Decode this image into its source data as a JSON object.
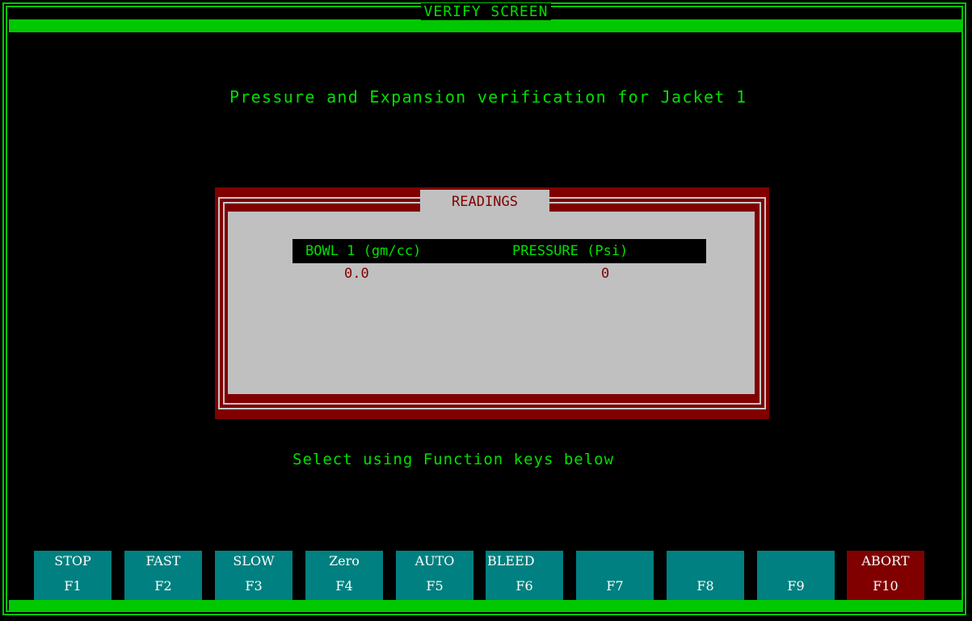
{
  "screen_title": "VERIFY SCREEN",
  "subtitle": "Pressure and Expansion verification for Jacket 1",
  "readings": {
    "title": "READINGS",
    "columns": [
      "BOWL 1 (gm/cc)",
      "PRESSURE (Psi)"
    ],
    "values": [
      "0.0",
      "0"
    ]
  },
  "instruction": "Select using Function keys below",
  "function_keys": [
    {
      "label": "STOP",
      "key": "F1"
    },
    {
      "label": "FAST",
      "key": "F2"
    },
    {
      "label": "SLOW",
      "key": "F3"
    },
    {
      "label": "Zero",
      "key": "F4"
    },
    {
      "label": "AUTO",
      "key": "F5"
    },
    {
      "label": "BLEED",
      "key": "F6"
    },
    {
      "label": "",
      "key": "F7"
    },
    {
      "label": "",
      "key": "F8"
    },
    {
      "label": "",
      "key": "F9"
    },
    {
      "label": "ABORT",
      "key": "F10"
    }
  ],
  "colors": {
    "background": "#000000",
    "frame": "#00c800",
    "text_green": "#00e000",
    "panel_maroon": "#800000",
    "panel_gray": "#c0c0c0",
    "key_teal": "#008080",
    "abort_red": "#800000"
  }
}
